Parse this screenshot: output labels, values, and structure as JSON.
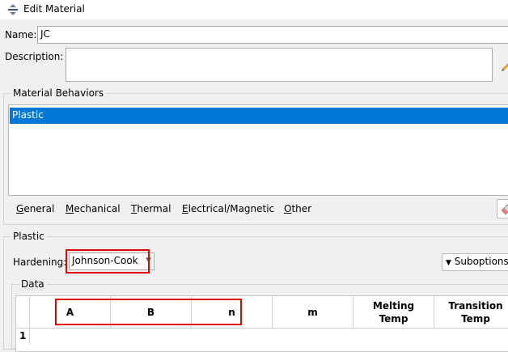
{
  "window": {
    "title": "Edit Material",
    "icon": "material-icon"
  },
  "name": {
    "label": "Name:",
    "value": "JC"
  },
  "description": {
    "label": "Description:",
    "value": "",
    "edit_icon": "pencil-icon"
  },
  "behaviors": {
    "group_label": "Material Behaviors",
    "items": [
      {
        "label": "Plastic",
        "selected": true
      }
    ],
    "selection_color": "#0078d7"
  },
  "menu": {
    "items": [
      {
        "mnemonic": "G",
        "rest": "eneral"
      },
      {
        "mnemonic": "M",
        "rest": "echanical"
      },
      {
        "mnemonic": "T",
        "rest": "hermal"
      },
      {
        "mnemonic": "E",
        "rest": "lectrical/Magnetic"
      },
      {
        "mnemonic": "O",
        "rest": "ther"
      }
    ],
    "delete_icon": "eraser-icon"
  },
  "plastic": {
    "group_label": "Plastic",
    "hardening_label": "Hardening:",
    "hardening_value": "Johnson-Cook",
    "suboptions_label": "Suboptions",
    "data_label": "Data"
  },
  "table": {
    "columns": [
      "A",
      "B",
      "n",
      "m",
      "Melting\nTemp",
      "Transition\nTemp"
    ],
    "rows": [
      {
        "index": "1",
        "cells": [
          "",
          "",
          "",
          "",
          "",
          ""
        ]
      }
    ]
  },
  "highlight_color": "#e00000"
}
